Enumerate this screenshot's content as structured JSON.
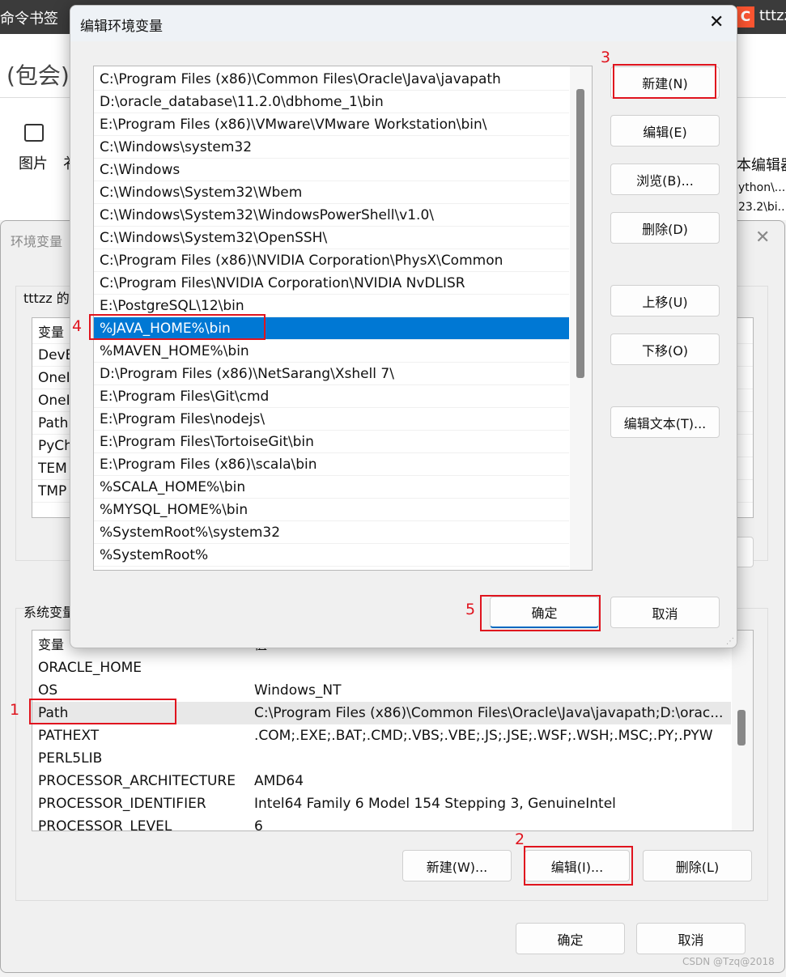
{
  "background_app": {
    "top_left_text": "命令书签",
    "brand_logo": "C",
    "user": "tttzz",
    "title_fragment": "(包会)",
    "toolbar_image_label": "图片",
    "toolbar_partial": "衤",
    "toolbar_right_label": "本编辑器",
    "right_text_1": "ython\\...",
    "right_text_2": "23.2\\bi..."
  },
  "env_dialog": {
    "title": "环境变量",
    "user_group_label": "tttzz 的",
    "user_vars_header": "变量",
    "user_vars": [
      "DevE",
      "OneI",
      "OneI",
      "Path",
      "PyCh",
      "TEM",
      "TMP"
    ],
    "system_group_label": "系统变量",
    "system_headers": {
      "name": "变量",
      "value": "值"
    },
    "system_vars": [
      {
        "name": "ORACLE_HOME",
        "value": ""
      },
      {
        "name": "OS",
        "value": "Windows_NT"
      },
      {
        "name": "Path",
        "value": "C:\\Program Files (x86)\\Common Files\\Oracle\\Java\\javapath;D:\\orac..."
      },
      {
        "name": "PATHEXT",
        "value": ".COM;.EXE;.BAT;.CMD;.VBS;.VBE;.JS;.JSE;.WSF;.WSH;.MSC;.PY;.PYW"
      },
      {
        "name": "PERL5LIB",
        "value": ""
      },
      {
        "name": "PROCESSOR_ARCHITECTURE",
        "value": "AMD64"
      },
      {
        "name": "PROCESSOR_IDENTIFIER",
        "value": "Intel64 Family 6 Model 154 Stepping 3, GenuineIntel"
      },
      {
        "name": "PROCESSOR_LEVEL",
        "value": "6"
      }
    ],
    "selected_system_var": "Path",
    "buttons": {
      "new": "新建(W)...",
      "edit": "编辑(I)...",
      "delete": "删除(L)",
      "ok": "确定",
      "cancel": "取消"
    }
  },
  "edit_dialog": {
    "title": "编辑环境变量",
    "paths": [
      "C:\\Program Files (x86)\\Common Files\\Oracle\\Java\\javapath",
      "D:\\oracle_database\\11.2.0\\dbhome_1\\bin",
      "E:\\Program Files (x86)\\VMware\\VMware Workstation\\bin\\",
      "C:\\Windows\\system32",
      "C:\\Windows",
      "C:\\Windows\\System32\\Wbem",
      "C:\\Windows\\System32\\WindowsPowerShell\\v1.0\\",
      "C:\\Windows\\System32\\OpenSSH\\",
      "C:\\Program Files (x86)\\NVIDIA Corporation\\PhysX\\Common",
      "C:\\Program Files\\NVIDIA Corporation\\NVIDIA NvDLISR",
      "E:\\PostgreSQL\\12\\bin",
      "%JAVA_HOME%\\bin",
      "%MAVEN_HOME%\\bin",
      "D:\\Program Files (x86)\\NetSarang\\Xshell 7\\",
      "E:\\Program Files\\Git\\cmd",
      "E:\\Program Files\\nodejs\\",
      "E:\\Program Files\\TortoiseGit\\bin",
      "E:\\Program Files (x86)\\scala\\bin",
      "%SCALA_HOME%\\bin",
      "%MYSQL_HOME%\\bin",
      "%SystemRoot%\\system32",
      "%SystemRoot%"
    ],
    "selected_path": "%JAVA_HOME%\\bin",
    "buttons": {
      "new": "新建(N)",
      "edit": "编辑(E)",
      "browse": "浏览(B)...",
      "delete": "删除(D)",
      "move_up": "上移(U)",
      "move_down": "下移(O)",
      "edit_text": "编辑文本(T)...",
      "ok": "确定",
      "cancel": "取消"
    }
  },
  "annotations": [
    "1",
    "2",
    "3",
    "4",
    "5"
  ],
  "watermark": "CSDN @Tzq@2018",
  "colors": {
    "selection": "#0078d4",
    "annotation": "#e0141e"
  }
}
